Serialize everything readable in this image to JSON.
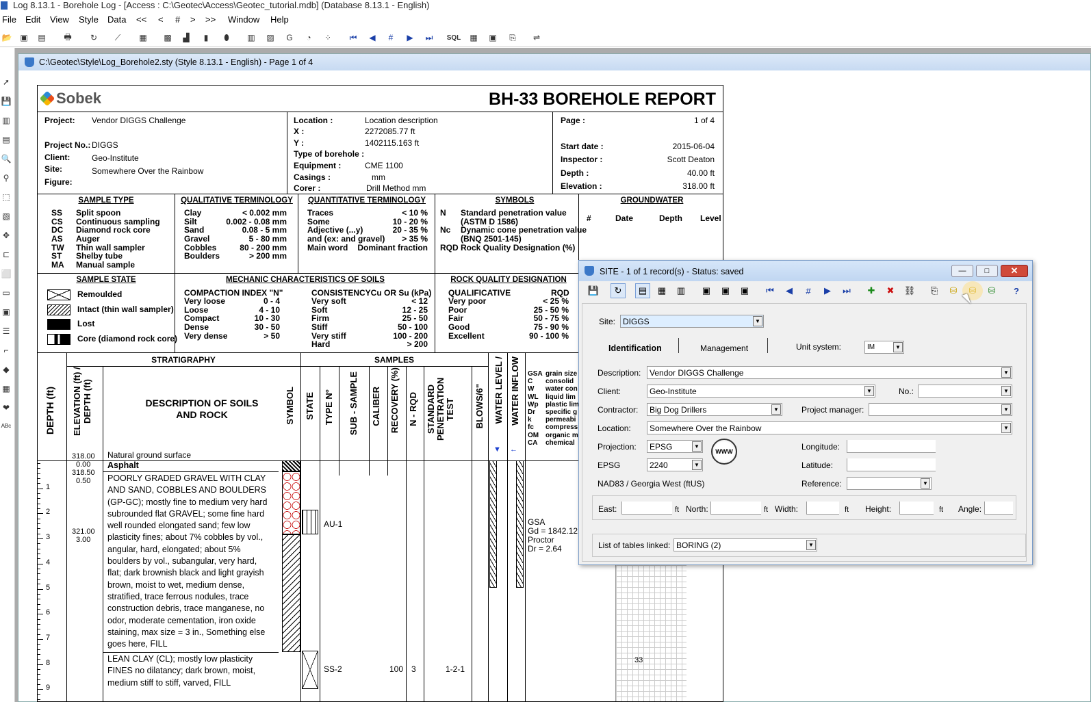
{
  "window_title": "Log 8.13.1 - Borehole Log - [Access : C:\\Geotec\\Access\\Geotec_tutorial.mdb] (Database 8.13.1 - English)",
  "menu": [
    "File",
    "Edit",
    "View",
    "Style",
    "Data",
    "<<",
    "<",
    "#",
    ">",
    ">>",
    "Window",
    "Help"
  ],
  "doc_title": "C:\\Geotec\\Style\\Log_Borehole2.sty (Style 8.13.1 - English) - Page 1 of 4",
  "report": {
    "logo": "Sobek",
    "title": "BH-33 BOREHOLE REPORT",
    "project_label": "Project:",
    "project": "Vendor DIGGS Challenge",
    "project_no_label": "Project No.:",
    "project_no": "DIGGS",
    "client_label": "Client:",
    "client": "Geo-Institute",
    "site_label": "Site:",
    "site": "Somewhere Over the Rainbow",
    "figure_label": "Figure:",
    "location_label": "Location :",
    "location": "Location description",
    "x_label": "X :",
    "x": "2272085.77 ft",
    "y_label": "Y :",
    "y": "1402115.163 ft",
    "type_label": "Type of borehole :",
    "equipment_label": "Equipment :",
    "equipment": "CME 1100",
    "casings_label": "Casings :",
    "casings": "mm",
    "corer_label": "Corer :",
    "corer": "Drill Method   mm",
    "page_label": "Page :",
    "page": "1 of 4",
    "start_label": "Start date :",
    "start": "2015-06-04",
    "inspector_label": "Inspector :",
    "inspector": "Scott Deaton",
    "depth_label": "Depth :",
    "depth": "40.00 ft",
    "elevation_label": "Elevation :",
    "elevation": "318.00 ft",
    "sample_type_hdr": "SAMPLE TYPE",
    "sample_types": [
      [
        "SS",
        "Split spoon"
      ],
      [
        "CS",
        "Continuous sampling"
      ],
      [
        "DC",
        "Diamond rock core"
      ],
      [
        "AS",
        "Auger"
      ],
      [
        "TW",
        "Thin wall sampler"
      ],
      [
        "ST",
        "Shelby tube"
      ],
      [
        "MA",
        "Manual sample"
      ]
    ],
    "qual_hdr": "QUALITATIVE TERMINOLOGY",
    "qual": [
      [
        "Clay",
        "< 0.002 mm"
      ],
      [
        "Silt",
        "0.002 - 0.08 mm"
      ],
      [
        "Sand",
        "0.08 - 5 mm"
      ],
      [
        "Gravel",
        "5 - 80 mm"
      ],
      [
        "Cobbles",
        "80 - 200 mm"
      ],
      [
        "Boulders",
        "> 200 mm"
      ]
    ],
    "quant_hdr": "QUANTITATIVE TERMINOLOGY",
    "quant": [
      [
        "Traces",
        "< 10 %"
      ],
      [
        "Some",
        "10 - 20 %"
      ],
      [
        "Adjective (...y)",
        "20 - 35 %"
      ],
      [
        "and (ex: and gravel)",
        "> 35 %"
      ],
      [
        "Main word",
        "Dominant fraction"
      ]
    ],
    "symbols_hdr": "SYMBOLS",
    "symbols": [
      [
        "N",
        "Standard penetration value"
      ],
      [
        "",
        "(ASTM D 1586)"
      ],
      [
        "Nc",
        "Dynamic cone penetration value"
      ],
      [
        "",
        "(BNQ 2501-145)"
      ],
      [
        "RQD",
        "Rock Quality Designation (%)"
      ]
    ],
    "gw_hdr": "GROUNDWATER",
    "gw_cols": [
      "#",
      "Date",
      "Depth",
      "Level"
    ],
    "state_hdr": "SAMPLE STATE",
    "states": [
      "Remoulded",
      "Intact (thin wall sampler)",
      "Lost",
      "Core (diamond rock core)"
    ],
    "mech_hdr": "MECHANIC CHARACTERISTICS OF SOILS",
    "compaction_hdr": "COMPACTION INDEX \"N\"",
    "compaction": [
      [
        "Very loose",
        "0 - 4"
      ],
      [
        "Loose",
        "4 - 10"
      ],
      [
        "Compact",
        "10 - 30"
      ],
      [
        "Dense",
        "30 - 50"
      ],
      [
        "Very dense",
        "> 50"
      ]
    ],
    "consistency_hdr": "CONSISTENCYCu OR Su (kPa)",
    "consistency": [
      [
        "Very soft",
        "< 12"
      ],
      [
        "Soft",
        "12 - 25"
      ],
      [
        "Firm",
        "25 - 50"
      ],
      [
        "Stiff",
        "50 - 100"
      ],
      [
        "Very stiff",
        "100 - 200"
      ],
      [
        "Hard",
        "> 200"
      ]
    ],
    "rqd_hdr": "ROCK QUALITY DESIGNATION",
    "rqd_cols": [
      "QUALIFICATIVE",
      "RQD"
    ],
    "rqd": [
      [
        "Very poor",
        "< 25 %"
      ],
      [
        "Poor",
        "25 - 50 %"
      ],
      [
        "Fair",
        "50 - 75 %"
      ],
      [
        "Good",
        "75 - 90 %"
      ],
      [
        "Excellent",
        "90 - 100 %"
      ]
    ],
    "strat_hdr": "STRATIGRAPHY",
    "samples_hdr": "SAMPLES",
    "col_depth": "DEPTH (ft)",
    "col_elev": "ELEVATION (ft) / DEPTH (ft)",
    "col_desc1": "DESCRIPTION OF SOILS",
    "col_desc2": "AND ROCK",
    "col_symbol": "SYMBOL",
    "col_state": "STATE",
    "col_type": "TYPE N°",
    "col_sub": "SUB - SAMPLE",
    "col_caliber": "CALIBER",
    "col_recovery": "RECOVERY (%)",
    "col_nrqd": "N - RQD",
    "col_spt": "STANDARD PENETRATION TEST",
    "col_blows": "BLOWS/6\"",
    "col_wl": "WATER LEVEL /",
    "col_wi": "WATER INFLOW",
    "abbrev": [
      [
        "GSA",
        "grain size"
      ],
      [
        "C",
        "consolid"
      ],
      [
        "W",
        "water con"
      ],
      [
        "WL",
        "liquid lim"
      ],
      [
        "Wp",
        "plastic lim"
      ],
      [
        "Dr",
        "specific g"
      ],
      [
        "k",
        "permeabi"
      ],
      [
        "fc",
        "compress"
      ],
      [
        "OM",
        "organic m"
      ],
      [
        "CA",
        "chemical"
      ]
    ],
    "ground_elev": "318.00",
    "ground_label": "Natural ground surface",
    "elevs": [
      "0.00",
      "318.50",
      "0.50",
      "321.00",
      "3.00"
    ],
    "depth_ticks": [
      "1",
      "2",
      "3",
      "4",
      "5",
      "6",
      "7",
      "8",
      "9"
    ],
    "layer1": "Asphalt",
    "layer2_lines": [
      "POORLY GRADED GRAVEL WITH CLAY",
      "AND SAND, COBBLES AND BOULDERS",
      "(GP-GC); mostly fine to medium very hard",
      "subrounded flat GRAVEL; some fine hard",
      "well rounded elongated sand; few low",
      "plasticity fines; about 7% cobbles by vol.,",
      "angular, hard, elongated; about 5%",
      "boulders by vol., subangular, very hard,",
      "flat; dark brownish black and light grayish",
      "brown, moist to wet, medium dense,",
      "stratified, trace ferrous nodules, trace",
      "construction debris, trace manganese, no",
      "odor, moderate cementation, iron oxide",
      "staining, max size = 3 in., Something else",
      "goes here, FILL"
    ],
    "layer3_lines": [
      "LEAN CLAY (CL); mostly low plasticity",
      "FINES no dilatancy; dark brown, moist,",
      "medium stiff to stiff, varved, FILL"
    ],
    "sample1": "AU-1",
    "sample2": "SS-2",
    "sample2_rec": "100",
    "sample2_n": "3",
    "sample2_blows": "1-2-1",
    "lab1": [
      "GSA",
      "Gd = 1842.12",
      "Proctor",
      "Dr = 2.64"
    ],
    "plot_val": "33"
  },
  "dialog": {
    "title": "SITE - 1 of 1 record(s) - Status: saved",
    "site_label": "Site:",
    "site": "DIGGS",
    "tabs": [
      "Identification",
      "Management"
    ],
    "unit_label": "Unit system:",
    "unit": "IM",
    "description_label": "Description:",
    "description": "Vendor DIGGS Challenge",
    "client_label": "Client:",
    "client": "Geo-Institute",
    "no_label": "No.:",
    "no": "",
    "contractor_label": "Contractor:",
    "contractor": "Big Dog Drillers",
    "pm_label": "Project manager:",
    "pm": "",
    "location_label": "Location:",
    "location": "Somewhere Over the Rainbow",
    "projection_label": "Projection:",
    "projection": "EPSG",
    "epsg_label": "EPSG",
    "epsg": "2240",
    "longitude_label": "Longitude:",
    "longitude": "",
    "latitude_label": "Latitude:",
    "latitude": "",
    "nad": "NAD83 / Georgia West (ftUS)",
    "reference_label": "Reference:",
    "reference": "",
    "east_label": "East:",
    "north_label": "North:",
    "width_label": "Width:",
    "height_label": "Height:",
    "angle_label": "Angle:",
    "unit_ft": "ft",
    "tables_label": "List of tables linked:",
    "tables": "BORING (2)",
    "www": "WWW"
  }
}
